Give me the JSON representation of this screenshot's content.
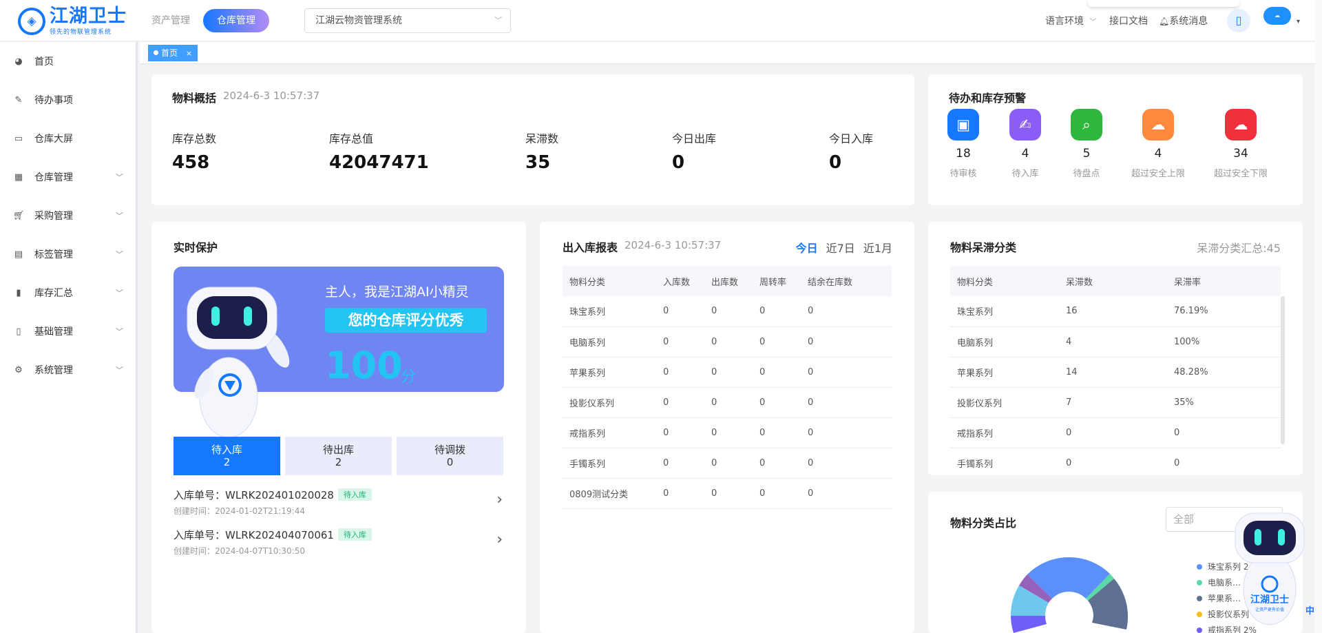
{
  "header": {
    "logo_title": "江湖卫士",
    "logo_subtitle": "领先的物联管理系统",
    "tabs": [
      "资产管理",
      "仓库管理"
    ],
    "active_tab": "仓库管理",
    "system_select": "江湖云物资管理系统",
    "language": "语言环境",
    "api_docs": "接口文档",
    "messages": "系统消息"
  },
  "sidebar": {
    "items": [
      {
        "label": "首页",
        "icon": "dashboard-icon",
        "expandable": false
      },
      {
        "label": "待办事项",
        "icon": "edit-icon",
        "expandable": false
      },
      {
        "label": "仓库大屏",
        "icon": "monitor-icon",
        "expandable": false
      },
      {
        "label": "仓库管理",
        "icon": "grid-icon",
        "expandable": true
      },
      {
        "label": "采购管理",
        "icon": "cart-icon",
        "expandable": true
      },
      {
        "label": "标签管理",
        "icon": "printer-icon",
        "expandable": true
      },
      {
        "label": "库存汇总",
        "icon": "bar-chart-icon",
        "expandable": true
      },
      {
        "label": "基础管理",
        "icon": "book-icon",
        "expandable": true
      },
      {
        "label": "系统管理",
        "icon": "gear-icon",
        "expandable": true
      }
    ]
  },
  "tagbar": {
    "tag": "首页"
  },
  "overview": {
    "title": "物料概括",
    "time": "2024-6-3 10:57:37",
    "stats": [
      {
        "label": "库存总数",
        "value": "458"
      },
      {
        "label": "库存总值",
        "value": "42047471"
      },
      {
        "label": "呆滞数",
        "value": "35"
      },
      {
        "label": "今日出库",
        "value": "0"
      },
      {
        "label": "今日入库",
        "value": "0"
      }
    ]
  },
  "alerts": {
    "title": "待办和库存预警",
    "items": [
      {
        "label": "待审核",
        "count": "18",
        "color": "#1677ff",
        "icon": "review-icon"
      },
      {
        "label": "待入库",
        "count": "4",
        "color": "#8b5cf6",
        "icon": "sign-icon"
      },
      {
        "label": "待盘点",
        "count": "5",
        "color": "#2db83d",
        "icon": "inventory-search-icon"
      },
      {
        "label": "超过安全上限",
        "count": "4",
        "color": "#ff8a3d",
        "icon": "cloud-upload-icon"
      },
      {
        "label": "超过安全下限",
        "count": "34",
        "color": "#f0303c",
        "icon": "cloud-download-icon"
      }
    ]
  },
  "protection": {
    "title": "实时保护",
    "greeting": "主人，我是江湖AI小精灵",
    "rating": "您的仓库评分优秀",
    "score": "100",
    "score_unit": "分",
    "segments": [
      {
        "label": "待入库",
        "count": "2"
      },
      {
        "label": "待出库",
        "count": "2"
      },
      {
        "label": "待调拨",
        "count": "0"
      }
    ],
    "orders": [
      {
        "no": "入库单号：WLRK202401020028",
        "badge": "待入库",
        "date": "创建时间：2024-01-02T21:19:44"
      },
      {
        "no": "入库单号：WLRK202404070061",
        "badge": "待入库",
        "date": "创建时间：2024-04-07T10:30:50"
      }
    ]
  },
  "io_report": {
    "title": "出入库报表",
    "time": "2024-6-3 10:57:37",
    "periods": [
      "今日",
      "近7日",
      "近1月"
    ],
    "active_period": "今日",
    "columns": [
      "物料分类",
      "入库数",
      "出库数",
      "周转率",
      "结余在库数"
    ],
    "rows": [
      [
        "珠宝系列",
        "0",
        "0",
        "0",
        "0"
      ],
      [
        "电脑系列",
        "0",
        "0",
        "0",
        "0"
      ],
      [
        "苹果系列",
        "0",
        "0",
        "0",
        "0"
      ],
      [
        "投影仪系列",
        "0",
        "0",
        "0",
        "0"
      ],
      [
        "戒指系列",
        "0",
        "0",
        "0",
        "0"
      ],
      [
        "手镯系列",
        "0",
        "0",
        "0",
        "0"
      ],
      [
        "0809测试分类",
        "0",
        "0",
        "0",
        "0"
      ]
    ]
  },
  "stagnant": {
    "title": "物料呆滞分类",
    "summary": "呆滞分类汇总:45",
    "columns": [
      "物料分类",
      "呆滞数",
      "呆滞率"
    ],
    "rows": [
      [
        "珠宝系列",
        "16",
        "76.19%"
      ],
      [
        "电脑系列",
        "4",
        "100%"
      ],
      [
        "苹果系列",
        "14",
        "48.28%"
      ],
      [
        "投影仪系列",
        "7",
        "35%"
      ],
      [
        "戒指系列",
        "0",
        "0"
      ],
      [
        "手镯系列",
        "0",
        "0"
      ]
    ]
  },
  "ratio": {
    "title": "物料分类占比",
    "filter_placeholder": "全部",
    "legend": [
      {
        "label": "珠宝系列 2…",
        "color": "#5b8ff9"
      },
      {
        "label": "电脑系…",
        "color": "#5ad8a6"
      },
      {
        "label": "苹果系…",
        "color": "#5d7092"
      },
      {
        "label": "投影仪系列",
        "color": "#f6bd16"
      },
      {
        "label": "戒指系列 2%",
        "color": "#6f5ef9"
      }
    ]
  },
  "float_assistant": {
    "logo": "江湖卫士",
    "slogan": "让资产更有价值"
  },
  "lang_indicator": "中"
}
